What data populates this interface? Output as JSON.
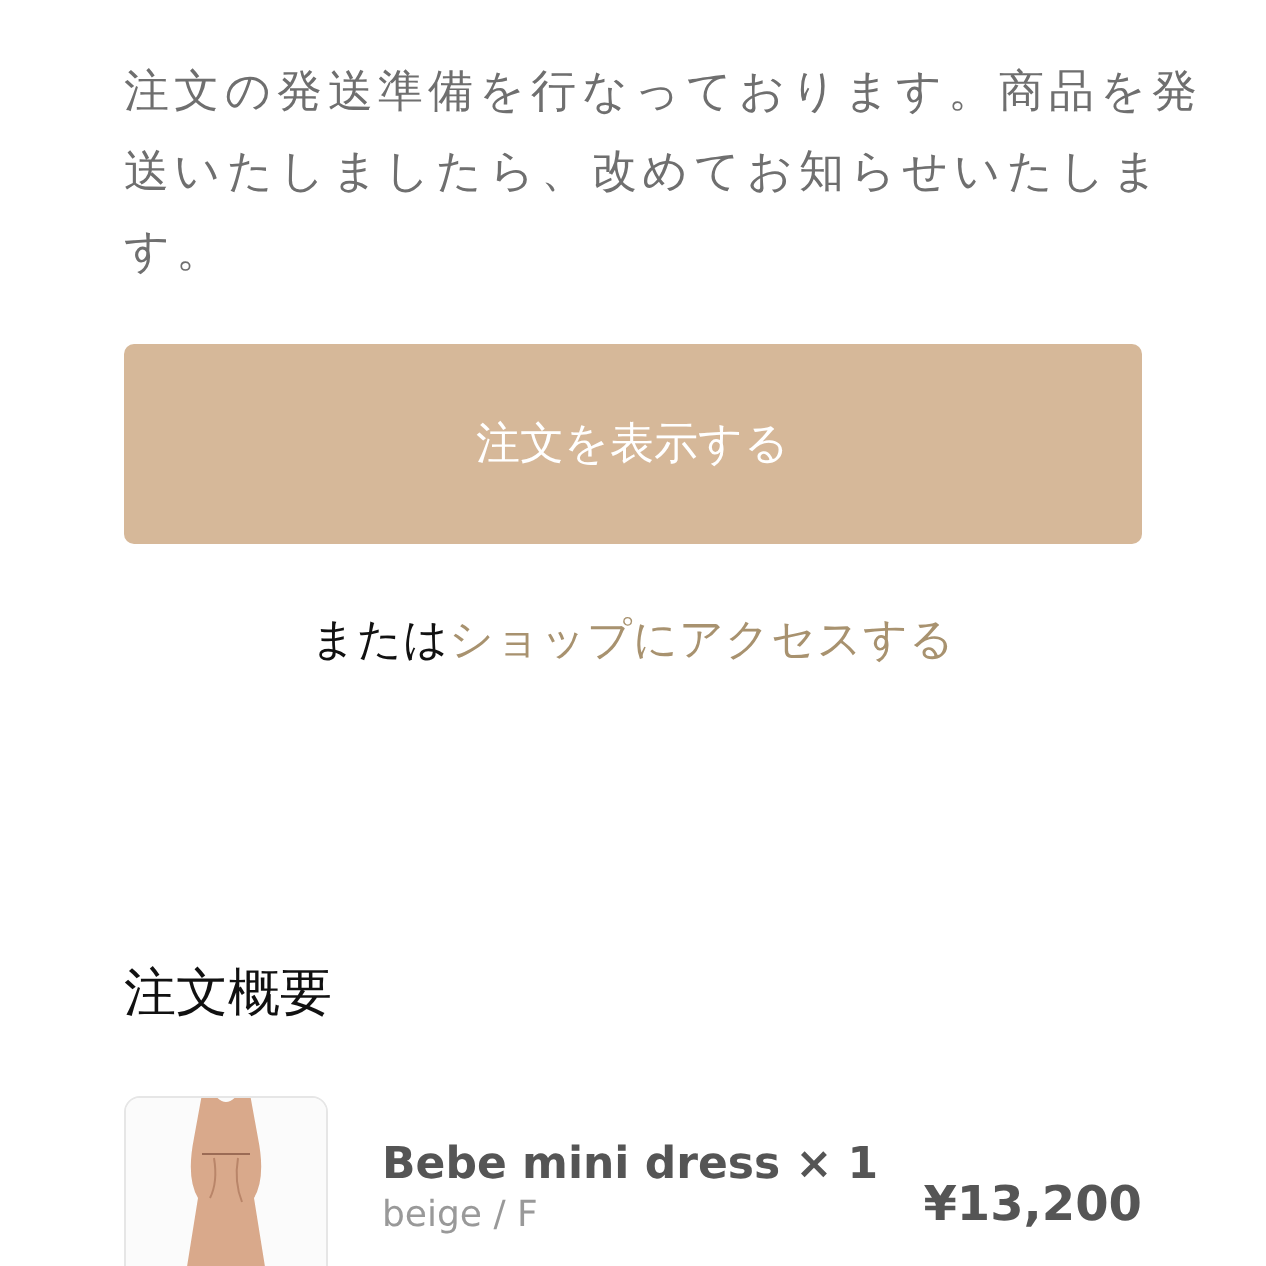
{
  "message": "注文の発送準備を行なっております。商品を発送いたしましたら、改めてお知らせいたします。",
  "view_order_button": {
    "label": "注文を表示する"
  },
  "shop_line": {
    "prefix": "または",
    "link": "ショップにアクセスする"
  },
  "summary": {
    "title": "注文概要",
    "items": [
      {
        "name": "Bebe mini dress × 1",
        "variant": "beige / F",
        "price": "¥13,200"
      }
    ]
  }
}
